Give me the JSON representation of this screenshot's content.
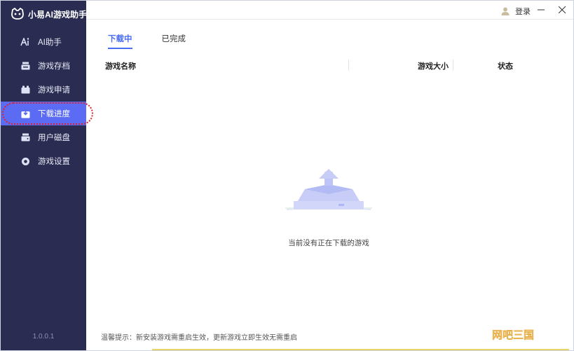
{
  "app": {
    "title": "小易AI游戏助手",
    "version": "1.0.0.1"
  },
  "sidebar": {
    "items": [
      {
        "label": "AI助手",
        "icon": "ai-icon"
      },
      {
        "label": "游戏存档",
        "icon": "save-archive-icon"
      },
      {
        "label": "游戏申请",
        "icon": "game-request-icon"
      },
      {
        "label": "下载进度",
        "icon": "download-icon",
        "active": true
      },
      {
        "label": "用户磁盘",
        "icon": "disk-icon"
      },
      {
        "label": "游戏设置",
        "icon": "settings-icon"
      }
    ]
  },
  "topbar": {
    "login_label": "登录"
  },
  "tabs": [
    {
      "label": "下载中",
      "active": true
    },
    {
      "label": "已完成",
      "active": false
    }
  ],
  "table": {
    "columns": [
      "游戏名称",
      "游戏大小",
      "状态"
    ]
  },
  "empty_state": {
    "message": "当前没有正在下载的游戏"
  },
  "footer": {
    "tip": "温馨提示：新安装游戏需重启生效，更新游戏立即生效无需重启"
  },
  "watermark": {
    "text": "网吧三国"
  },
  "colors": {
    "sidebar_bg": "#2a2c52",
    "accent": "#5b6bf3",
    "tab_active": "#4a6cf2",
    "highlight_ring": "#e0202a"
  }
}
